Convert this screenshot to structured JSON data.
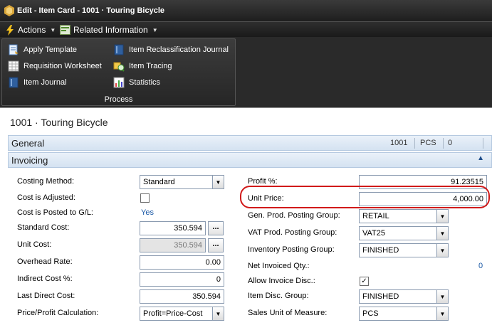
{
  "window": {
    "title": "Edit - Item Card - 1001 · Touring Bicycle"
  },
  "menubar": {
    "actions": "Actions",
    "related_information": "Related Information"
  },
  "ribbon": {
    "group_caption": "Process",
    "items": [
      {
        "label": "Apply Template",
        "icon": "template-icon"
      },
      {
        "label": "Requisition Worksheet",
        "icon": "worksheet-icon"
      },
      {
        "label": "Item Journal",
        "icon": "journal-icon"
      },
      {
        "label": "Item Reclassification Journal",
        "icon": "reclass-journal-icon"
      },
      {
        "label": "Item Tracing",
        "icon": "tracing-icon"
      },
      {
        "label": "Statistics",
        "icon": "statistics-icon"
      }
    ]
  },
  "page": {
    "title": "1001 · Touring Bicycle"
  },
  "general_tab": {
    "label": "General",
    "no": "1001",
    "uom": "PCS",
    "inventory": "0"
  },
  "invoicing_tab": {
    "label": "Invoicing"
  },
  "left_fields": {
    "costing_method": {
      "label": "Costing Method:",
      "value": "Standard"
    },
    "cost_is_adjusted": {
      "label": "Cost is Adjusted:",
      "checked": false
    },
    "cost_is_posted": {
      "label": "Cost is Posted to G/L:",
      "value": "Yes"
    },
    "standard_cost": {
      "label": "Standard Cost:",
      "value": "350.594"
    },
    "unit_cost": {
      "label": "Unit Cost:",
      "value": "350.594"
    },
    "overhead_rate": {
      "label": "Overhead Rate:",
      "value": "0.00"
    },
    "indirect_cost": {
      "label": "Indirect Cost %:",
      "value": "0"
    },
    "last_direct_cost": {
      "label": "Last Direct Cost:",
      "value": "350.594"
    },
    "price_profit_calc": {
      "label": "Price/Profit Calculation:",
      "value": "Profit=Price-Cost"
    }
  },
  "right_fields": {
    "profit_pct": {
      "label": "Profit %:",
      "value": "91.23515"
    },
    "unit_price": {
      "label": "Unit Price:",
      "value": "4,000.00"
    },
    "gen_prod_posting_group": {
      "label": "Gen. Prod. Posting Group:",
      "value": "RETAIL"
    },
    "vat_prod_posting_group": {
      "label": "VAT Prod. Posting Group:",
      "value": "VAT25"
    },
    "inventory_posting_group": {
      "label": "Inventory Posting Group:",
      "value": "FINISHED"
    },
    "net_invoiced_qty": {
      "label": "Net Invoiced Qty.:",
      "value": "0"
    },
    "allow_invoice_disc": {
      "label": "Allow Invoice Disc.:",
      "checked": true
    },
    "item_disc_group": {
      "label": "Item Disc. Group:",
      "value": "FINISHED"
    },
    "sales_unit_of_measure": {
      "label": "Sales Unit of Measure:",
      "value": "PCS"
    }
  },
  "assist_button_label": "...",
  "colors": {
    "highlight": "#d11a1a",
    "link": "#1c5aa6",
    "tab_bg": "#d4e2f1"
  }
}
